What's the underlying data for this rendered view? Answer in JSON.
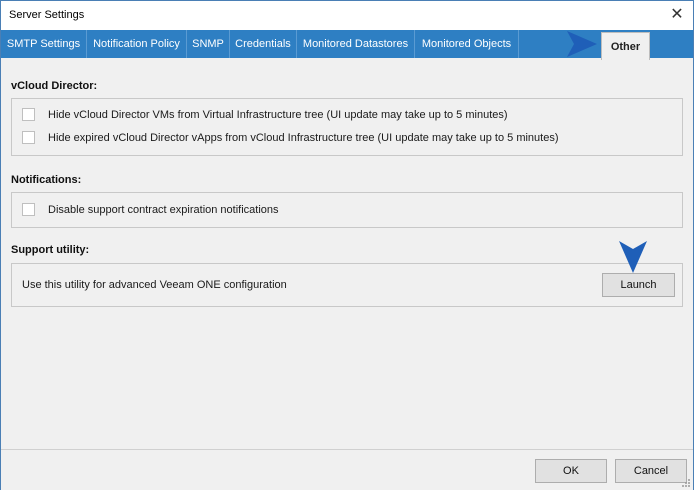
{
  "window": {
    "title": "Server Settings",
    "close_glyph": "✕"
  },
  "tabs": [
    {
      "label": "SMTP Settings"
    },
    {
      "label": "Notification Policy"
    },
    {
      "label": "SNMP"
    },
    {
      "label": "Credentials"
    },
    {
      "label": "Monitored Datastores"
    },
    {
      "label": "Monitored Objects"
    },
    {
      "label": "Other",
      "active": true
    }
  ],
  "vcloud": {
    "title": "vCloud Director:",
    "options": [
      {
        "label": "Hide vCloud Director VMs from Virtual Infrastructure tree (UI update may take up to 5 minutes)",
        "checked": false
      },
      {
        "label": "Hide expired vCloud Director vApps from vCloud Infrastructure tree (UI update may take up to 5 minutes)",
        "checked": false
      }
    ]
  },
  "notifications": {
    "title": "Notifications:",
    "options": [
      {
        "label": "Disable support contract expiration notifications",
        "checked": false
      }
    ]
  },
  "support": {
    "title": "Support utility:",
    "description": "Use this utility for advanced Veeam ONE configuration",
    "launch_label": "Launch"
  },
  "footer": {
    "ok_label": "OK",
    "cancel_label": "Cancel"
  },
  "colors": {
    "tabbar": "#2e7fc3",
    "arrow": "#1f5fb8"
  }
}
